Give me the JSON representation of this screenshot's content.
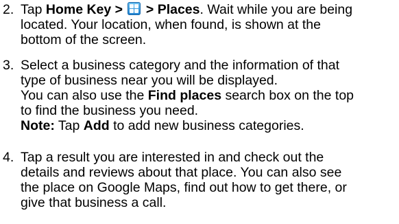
{
  "steps": [
    {
      "number": "2.",
      "lines": {
        "tap": "Tap ",
        "home_key": "Home Key >",
        "places": " > Places",
        "rest1": ". Wait while you are being",
        "l2": "located. Your location, when found, is shown at the",
        "l3": "bottom of the screen."
      },
      "icon": "app-grid-icon"
    },
    {
      "number": "3.",
      "lines": {
        "l1": "Select a business category and the information of that",
        "l2": "type of business near you will be displayed.",
        "l3a": "You can also use the ",
        "l3b": "Find places",
        "l3c": " search box on the top",
        "l4": "to find the business you need.",
        "note_label": "Note:",
        "note_a": " Tap ",
        "note_b": "Add",
        "note_c": " to add new business categories."
      }
    },
    {
      "number": "4.",
      "lines": {
        "l1": "Tap a result you are interested in and check out the",
        "l2": "details and reviews about that place. You can also see",
        "l3": "the place on Google Maps, find out how to get there, or",
        "l4": "give that business a call."
      }
    }
  ]
}
